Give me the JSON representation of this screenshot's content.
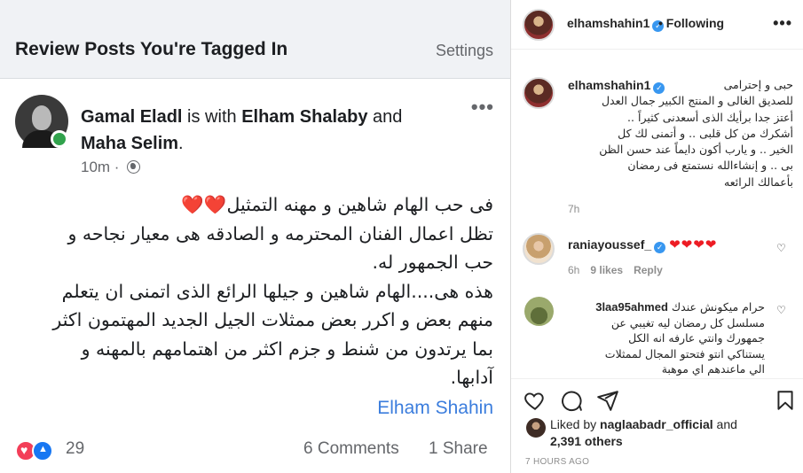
{
  "facebook": {
    "header": {
      "title": "Review Posts You're Tagged In",
      "settings": "Settings"
    },
    "post": {
      "author_name": "Gamal Eladl",
      "with_text": " is with ",
      "tagged_1": "Elham Shalaby",
      "and_text": " and ",
      "tagged_2": "Maha Selim",
      "period": ".",
      "time": "10m · ",
      "body_lines": [
        "فى حب الهام شاهين و مهنه التمثيل",
        "تظل اعمال الفنان المحترمه و الصادقه هى معيار نجاحه و",
        "حب الجمهور له.",
        "هذه هى....الهام شاهين و جيلها الرائع الذى اتمنى ان يتعلم",
        "منهم بعض و اكرر بعض ممثلات الجيل الجديد المهتمون اكثر",
        "بما يرتدون من شنط و جزم اكثر من اهتمامهم بالمهنه و",
        "آدابها."
      ],
      "hearts": "❤️❤️",
      "signature": "Elham Shahin",
      "reaction_count": "29",
      "comments": "6 Comments",
      "shares": "1 Share"
    }
  },
  "instagram": {
    "header": {
      "username": "elhamshahin1",
      "following": "• Following"
    },
    "caption": {
      "username": "elhamshahin1",
      "lines": [
        "حبى و إحترامى",
        "للصديق الغالى و المنتج الكبير جمال العدل",
        "أعتز جدا برأيك الذى أسعدنى كثيراً ..",
        "أشكرك من كل قلبى .. و أتمنى لك كل",
        "الخير .. و يارب أكون دايماً عند حسن الظن",
        "بى .. و إنشاءالله نستمتع فى رمضان",
        "بأعمالك الرائعه"
      ],
      "time": "7h"
    },
    "comments": [
      {
        "username": "raniayoussef_",
        "text": "❤❤❤❤",
        "time": "6h",
        "likes": "9 likes",
        "reply": "Reply"
      },
      {
        "username": "3laa95ahmed",
        "lines": [
          "حرام ميكونش عندك",
          "مسلسل كل رمضان ليه تغيبي عن",
          "جمهورك وانتي عارفه انه الكل",
          "يستناكي انتو فتحتو المجال لممثلات",
          "الي ماعندهم اي موهبة"
        ]
      }
    ],
    "liked_by_prefix": "Liked by ",
    "liked_by_user": "naglaabadr_official",
    "liked_by_and": " and ",
    "liked_by_others": "2,391 others",
    "timestamp": "7 HOURS AGO",
    "icons": [
      "heart-icon",
      "comment-icon",
      "share-icon",
      "bookmark-icon"
    ]
  }
}
